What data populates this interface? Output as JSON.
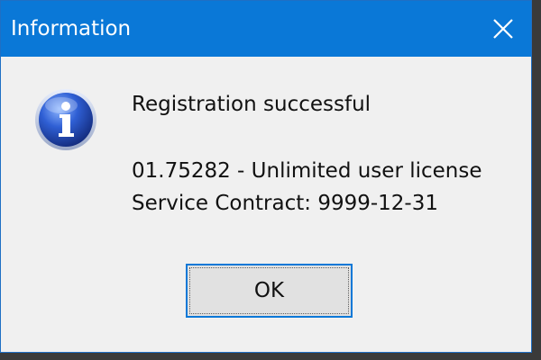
{
  "window": {
    "title": "Information",
    "close_icon": "close-icon"
  },
  "message": {
    "icon": "info-icon",
    "line1": "Registration successful",
    "line2": "01.75282 - Unlimited user license",
    "line3": "Service Contract: 9999-12-31"
  },
  "buttons": {
    "ok_label": "OK"
  },
  "colors": {
    "titlebar": "#0a78d7",
    "body": "#f0f0f0",
    "button_border": "#0a78d7"
  }
}
